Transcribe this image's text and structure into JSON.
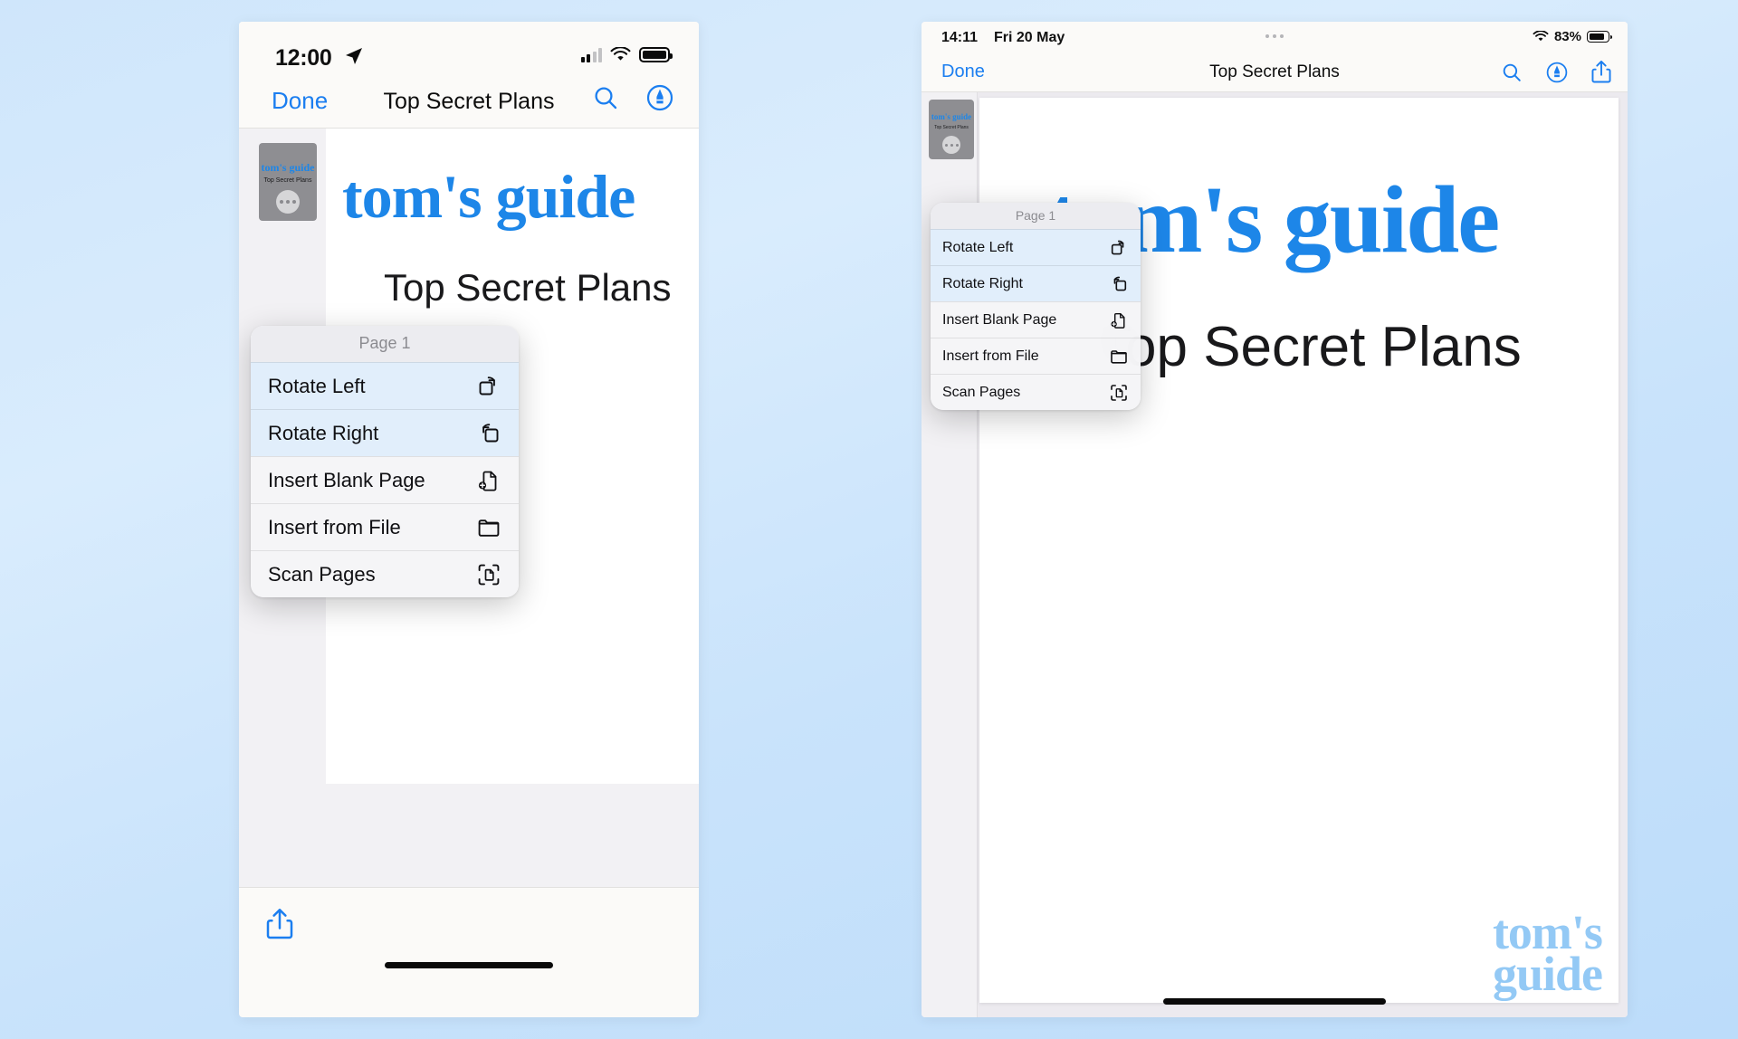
{
  "colors": {
    "accent_blue": "#1b7ef0",
    "brand_blue": "#1d86e8",
    "watermark_blue": "#93c9f5",
    "menu_bg": "#f5f5f7",
    "highlight": "#dfeefc",
    "page_bg": "#ffffff",
    "desktop_bg": "#cfe6fb"
  },
  "phone": {
    "status": {
      "time": "12:00",
      "location_icon": "location-arrow-icon",
      "cellular_icon": "cellular-signal-icon",
      "wifi_icon": "wifi-icon",
      "battery_icon": "battery-icon"
    },
    "nav": {
      "done_label": "Done",
      "title": "Top Secret Plans",
      "search_icon": "search-icon",
      "markup_icon": "markup-pen-icon"
    },
    "thumbnail": {
      "brand": "tom's guide",
      "subtitle": "Top Secret Plans",
      "more_icon": "more-dots-icon"
    },
    "document": {
      "brand": "tom's guide",
      "subtitle": "Top Secret Plans"
    },
    "toolbar": {
      "share_icon": "share-icon"
    },
    "home_indicator": "home-indicator"
  },
  "tablet": {
    "status": {
      "time": "14:11",
      "date": "Fri 20 May",
      "dynamic_dots": "dynamic-island-dots",
      "wifi_icon": "wifi-icon",
      "battery_percent": "83%",
      "battery_icon": "battery-icon"
    },
    "nav": {
      "done_label": "Done",
      "title": "Top Secret Plans",
      "search_icon": "search-icon",
      "markup_icon": "markup-pen-icon",
      "share_icon": "share-icon"
    },
    "thumbnail": {
      "brand": "tom's guide",
      "subtitle": "Top Secret Plans",
      "more_icon": "more-dots-icon"
    },
    "document": {
      "brand": "tom's guide",
      "subtitle": "Top Secret Plans"
    },
    "watermark": {
      "line1": "tom's",
      "line2": "guide"
    },
    "home_indicator": "home-indicator"
  },
  "context_menu": {
    "header": "Page 1",
    "items": [
      {
        "label": "Rotate Left",
        "icon": "rotate-left-icon",
        "highlighted": true
      },
      {
        "label": "Rotate Right",
        "icon": "rotate-right-icon",
        "highlighted": true
      },
      {
        "label": "Insert Blank Page",
        "icon": "insert-blank-page-icon",
        "highlighted": false
      },
      {
        "label": "Insert from File",
        "icon": "folder-icon",
        "highlighted": false
      },
      {
        "label": "Scan Pages",
        "icon": "scan-pages-icon",
        "highlighted": false
      }
    ]
  }
}
